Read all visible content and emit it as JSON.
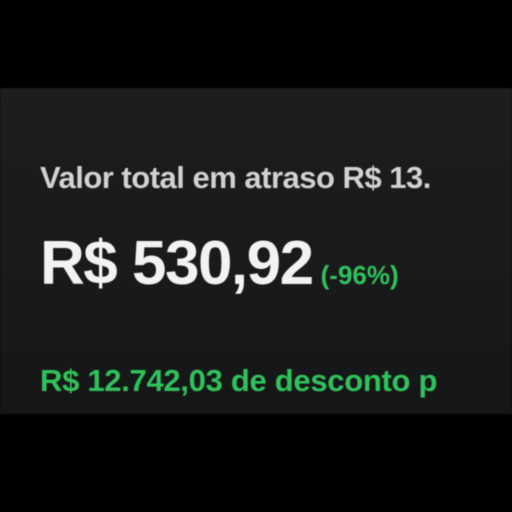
{
  "summary": {
    "overdue_total_text": "Valor total em atraso R$ 13.",
    "offer_price": "R$ 530,92",
    "discount_percent": "(-96%)",
    "discount_text": "R$ 12.742,03 de desconto p"
  },
  "colors": {
    "screen_background": "#1b1c1e",
    "primary_text": "#f2f2f2",
    "secondary_text": "#d2d2d2",
    "accent_green": "#2fc25b"
  }
}
